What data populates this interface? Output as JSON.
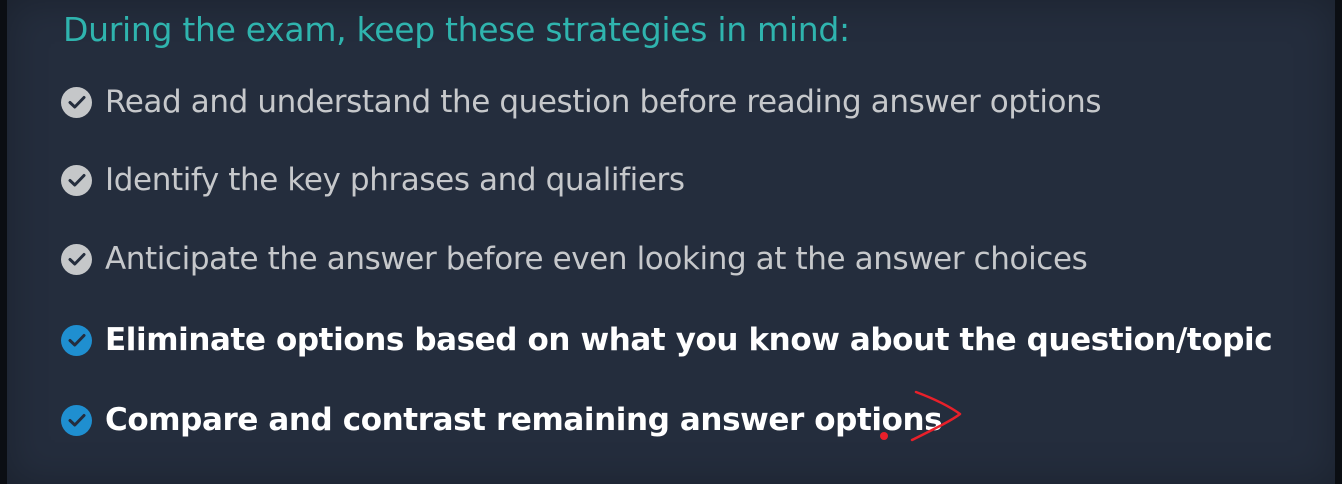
{
  "slide": {
    "title": "During the exam, keep these strategies in mind:",
    "bullets": [
      {
        "text": "Read and understand the question before reading answer options",
        "state": "past"
      },
      {
        "text": "Identify the key phrases and qualifiers",
        "state": "past"
      },
      {
        "text": "Anticipate the answer before even looking at the answer choices",
        "state": "past"
      },
      {
        "text": "Eliminate options based on what you know about the question/topic",
        "state": "current"
      },
      {
        "text": "Compare and contrast remaining answer options",
        "state": "current"
      }
    ],
    "bullet_icon": "check-circle-icon",
    "colors": {
      "background": "#242d3d",
      "title": "#2fb4ae",
      "past_text": "#c6c8cb",
      "current_text": "#ffffff",
      "past_check": "#c5c7c9",
      "current_check": "#1f8fd0",
      "annotation": "#e8202a"
    },
    "annotation_icon": "pen-arrow-icon"
  }
}
